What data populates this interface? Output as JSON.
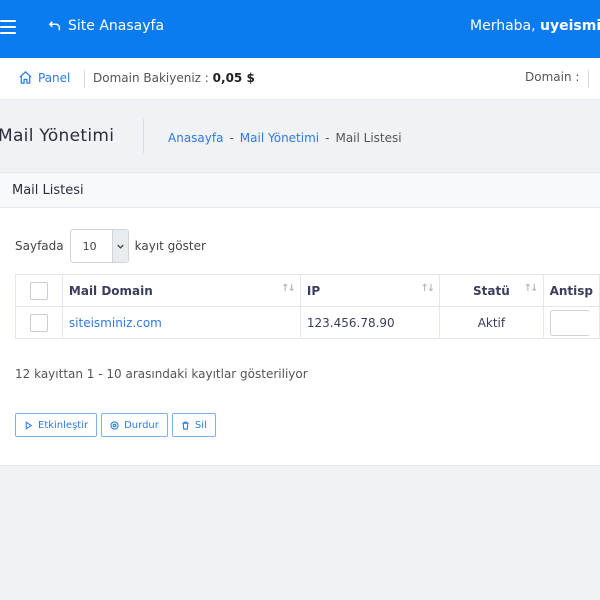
{
  "topbar": {
    "site_home": "Site Anasayfa",
    "greeting_prefix": "Merhaba, ",
    "username": "uyeisminiz",
    "accent": "#0a7cf0"
  },
  "subbar": {
    "panel": "Panel",
    "balance_label": "Domain Bakiyeniz : ",
    "balance_value": "0,05 $",
    "domain_label": "Domain :"
  },
  "page": {
    "title": "Mail Yönetimi",
    "breadcrumb": [
      {
        "label": "Anasayfa"
      },
      {
        "label": "-"
      },
      {
        "label": "Mail Yönetimi"
      },
      {
        "label": "-"
      },
      {
        "label": "Mail Listesi"
      }
    ]
  },
  "card": {
    "title": "Mail Listesi",
    "length": {
      "before": "Sayfada",
      "value": "10",
      "after": "kayıt göster"
    },
    "columns": [
      "Mail Domain",
      "IP",
      "Statü",
      "Antisp"
    ],
    "rows": [
      {
        "domain": "siteisminiz.com",
        "ip": "123.456.78.90",
        "status": "Aktif"
      }
    ],
    "info": "12 kayıttan 1 - 10 arasındaki kayıtlar gösteriliyor",
    "buttons": {
      "activate": "Etkinleştir",
      "stop": "Durdur",
      "delete": "Sil"
    }
  },
  "icons": [
    "menu-icon",
    "return-arrow-icon",
    "home-icon",
    "chevron-down-icon",
    "sort-icon",
    "play-icon",
    "stop-circle-icon",
    "trash-icon"
  ]
}
